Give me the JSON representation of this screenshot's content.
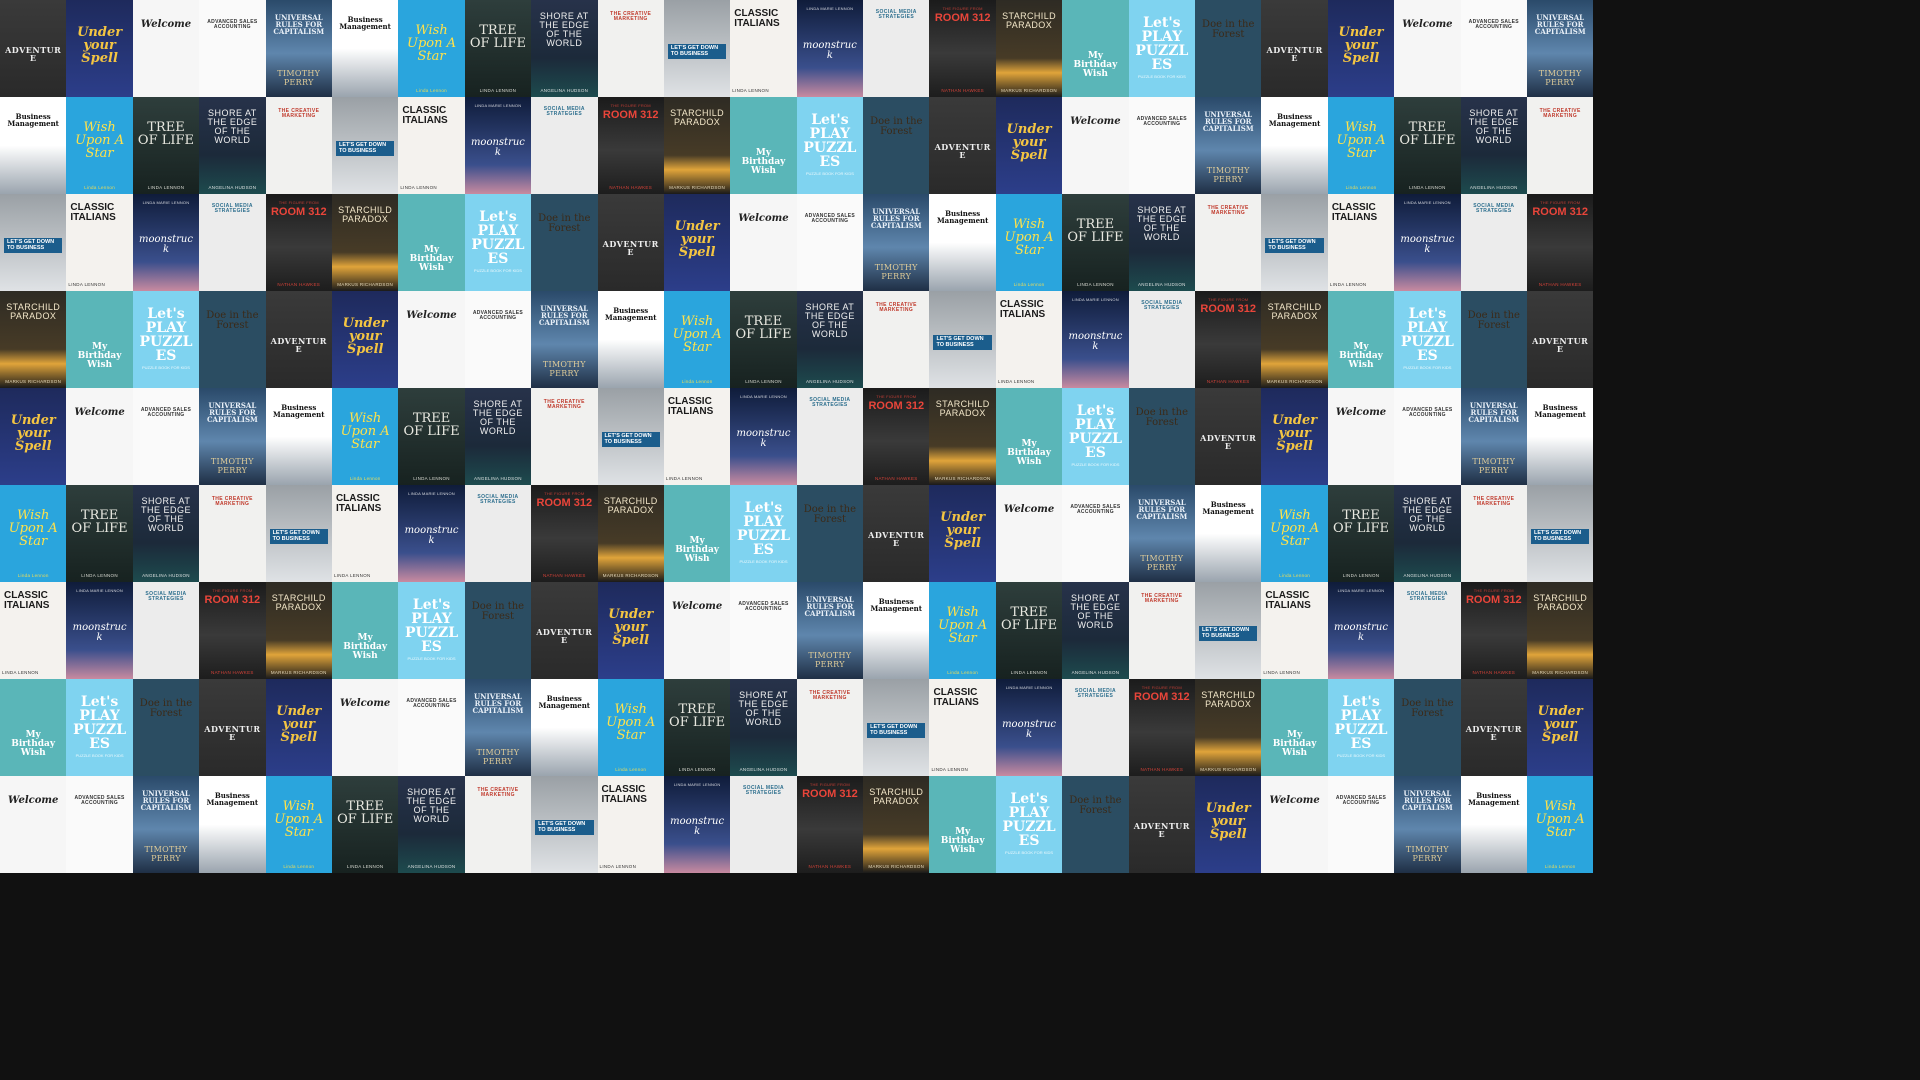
{
  "covers": [
    {
      "id": "adventure",
      "top": "",
      "title": "ADVENTURE",
      "sub": "",
      "author": ""
    },
    {
      "id": "spell",
      "top": "",
      "title": "Under your Spell",
      "sub": "",
      "author": ""
    },
    {
      "id": "welcome",
      "top": "",
      "title": "Welcome",
      "sub": "",
      "author": ""
    },
    {
      "id": "advanced",
      "top": "",
      "title": "ADVANCED SALES ACCOUNTING",
      "sub": "",
      "author": ""
    },
    {
      "id": "universal",
      "top": "",
      "title": "UNIVERSAL RULES FOR CAPITALISM",
      "sub": "",
      "author": "TIMOTHY PERRY"
    },
    {
      "id": "business",
      "top": "",
      "title": "Business Management",
      "sub": "",
      "author": ""
    },
    {
      "id": "wish",
      "top": "",
      "title": "Wish Upon A Star",
      "sub": "",
      "author": "Linda Lennon"
    },
    {
      "id": "tree",
      "top": "",
      "title": "TREE OF LIFE",
      "sub": "",
      "author": "LINDA LENNON"
    },
    {
      "id": "shore",
      "top": "",
      "title": "SHORE AT THE EDGE OF THE WORLD",
      "sub": "",
      "author": "ANGELINA HUDSON"
    },
    {
      "id": "creative",
      "top": "",
      "title": "THE CREATIVE MARKETING",
      "sub": "",
      "author": ""
    },
    {
      "id": "down",
      "top": "",
      "title": "LET'S GET DOWN TO BUSINESS",
      "sub": "",
      "author": ""
    },
    {
      "id": "italians",
      "top": "",
      "title": "CLASSIC ITALIANS",
      "sub": "",
      "author": "LINDA LENNON"
    },
    {
      "id": "moon",
      "top": "LINDA MARIE LENNON",
      "title": "moonstruck",
      "sub": "",
      "author": ""
    },
    {
      "id": "social",
      "top": "",
      "title": "SOCIAL MEDIA STRATEGIES",
      "sub": "",
      "author": ""
    },
    {
      "id": "room",
      "top": "THE FIGURE FROM",
      "title": "ROOM 312",
      "sub": "",
      "author": "NATHAN HAWKES"
    },
    {
      "id": "starchild",
      "top": "",
      "title": "STARCHILD PARADOX",
      "sub": "",
      "author": "MARKUS RICHARDSON"
    },
    {
      "id": "bear",
      "top": "",
      "title": "My Birthday Wish",
      "sub": "",
      "author": ""
    },
    {
      "id": "play",
      "top": "",
      "title": "Let's PLAY PUZZLES",
      "sub": "PUZZLE BOOK FOR KIDS",
      "author": ""
    },
    {
      "id": "doe",
      "top": "",
      "title": "Doe in the Forest",
      "sub": "",
      "author": ""
    }
  ],
  "tile_count": 216
}
